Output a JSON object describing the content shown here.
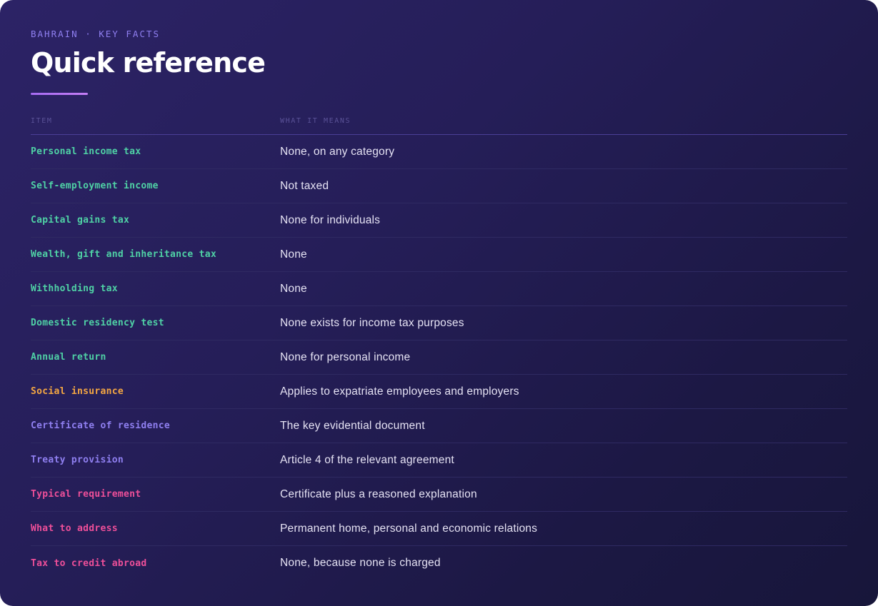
{
  "header": {
    "eyebrow": "BAHRAIN · KEY FACTS",
    "title": "Quick reference"
  },
  "table": {
    "columns": [
      "ITEM",
      "WHAT IT MEANS"
    ],
    "rows": [
      {
        "item": "Personal income tax",
        "meaning": "None, on any category",
        "color": "#4fd1a5"
      },
      {
        "item": "Self-employment income",
        "meaning": "Not taxed",
        "color": "#4fd1a5"
      },
      {
        "item": "Capital gains tax",
        "meaning": "None for individuals",
        "color": "#4fd1a5"
      },
      {
        "item": "Wealth, gift and inheritance tax",
        "meaning": "None",
        "color": "#4fd1a5"
      },
      {
        "item": "Withholding tax",
        "meaning": "None",
        "color": "#4fd1a5"
      },
      {
        "item": "Domestic residency test",
        "meaning": "None exists for income tax purposes",
        "color": "#4fd1a5"
      },
      {
        "item": "Annual return",
        "meaning": "None for personal income",
        "color": "#4fd1a5"
      },
      {
        "item": "Social insurance",
        "meaning": "Applies to expatriate employees and employers",
        "color": "#f5a742"
      },
      {
        "item": "Certificate of residence",
        "meaning": "The key evidential document",
        "color": "#8f7ff0"
      },
      {
        "item": "Treaty provision",
        "meaning": "Article 4 of the relevant agreement",
        "color": "#8f7ff0"
      },
      {
        "item": "Typical requirement",
        "meaning": "Certificate plus a reasoned explanation",
        "color": "#ee4f99"
      },
      {
        "item": "What to address",
        "meaning": "Permanent home, personal and economic relations",
        "color": "#ee4f99"
      },
      {
        "item": "Tax to credit abroad",
        "meaning": "None, because none is charged",
        "color": "#ee4f99"
      }
    ]
  }
}
